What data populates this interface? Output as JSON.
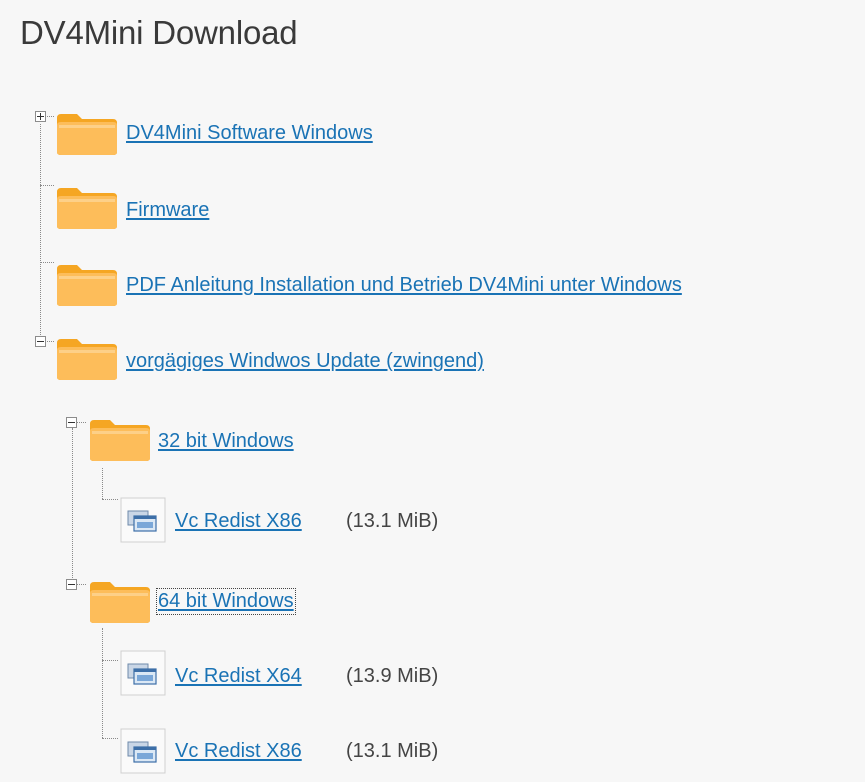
{
  "page": {
    "title": "DV4Mini Download"
  },
  "tree": {
    "items": [
      {
        "label": "DV4Mini Software Windows",
        "type": "folder",
        "expander": "plus"
      },
      {
        "label": "Firmware",
        "type": "folder"
      },
      {
        "label": "PDF Anleitung Installation und Betrieb DV4Mini unter Windows",
        "type": "folder"
      },
      {
        "label": "vorgägiges Windwos Update (zwingend)",
        "type": "folder",
        "expander": "minus",
        "children": [
          {
            "label": "32 bit Windows",
            "type": "folder",
            "expander": "minus",
            "children": [
              {
                "label": "Vc Redist X86",
                "type": "file",
                "size": "(13.1 MiB)"
              }
            ]
          },
          {
            "label": "64 bit Windows",
            "type": "folder",
            "expander": "minus",
            "focused": true,
            "children": [
              {
                "label": "Vc Redist X64",
                "type": "file",
                "size": "(13.9 MiB)"
              },
              {
                "label": "Vc Redist X86",
                "type": "file",
                "size": "(13.1 MiB)"
              }
            ]
          }
        ]
      }
    ]
  },
  "colors": {
    "link": "#1a73b5",
    "folder_light": "#fdd08a",
    "folder_dark": "#f5a623",
    "connector": "#8a8a8a"
  },
  "icons": {
    "expander_plus": "plus-box-icon",
    "expander_minus": "minus-box-icon",
    "folder": "folder-icon",
    "file": "installer-file-icon"
  }
}
